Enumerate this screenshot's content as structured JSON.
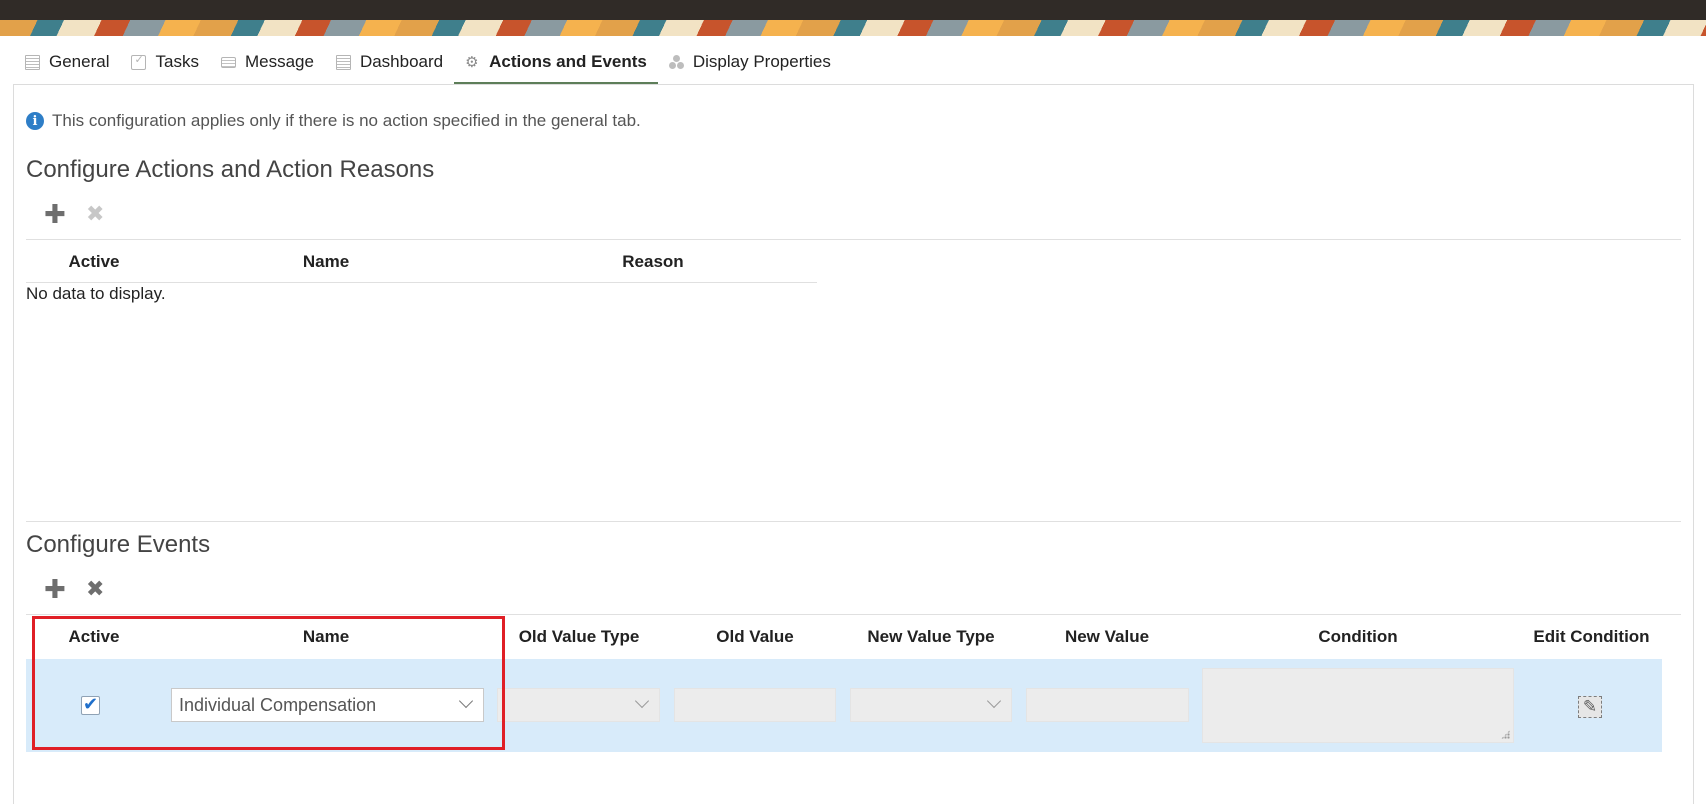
{
  "tabs": [
    {
      "label": "General",
      "icon": "document-icon"
    },
    {
      "label": "Tasks",
      "icon": "clipboard-check-icon"
    },
    {
      "label": "Message",
      "icon": "message-icon"
    },
    {
      "label": "Dashboard",
      "icon": "dashboard-icon"
    },
    {
      "label": "Actions and Events",
      "icon": "gears-icon",
      "active": true
    },
    {
      "label": "Display Properties",
      "icon": "circles-icon"
    }
  ],
  "info": {
    "text": "This configuration applies only if there is no action specified in the general tab.",
    "icon_glyph": "i"
  },
  "actions_section": {
    "title": "Configure Actions and Action Reasons",
    "add_glyph": "✚",
    "delete_glyph": "✖",
    "columns": [
      "Active",
      "Name",
      "Reason"
    ],
    "empty_text": "No data to display."
  },
  "events_section": {
    "title": "Configure Events",
    "add_glyph": "✚",
    "delete_glyph": "✖",
    "columns": [
      "Active",
      "Name",
      "Old Value Type",
      "Old Value",
      "New Value Type",
      "New Value",
      "Condition",
      "Edit Condition"
    ],
    "rows": [
      {
        "active": true,
        "name": "Individual Compensation",
        "old_value_type": "",
        "old_value": "",
        "new_value_type": "",
        "new_value": "",
        "condition": ""
      }
    ],
    "edit_glyph": "✎"
  },
  "colors": {
    "active_tab_underline": "#5d7e59",
    "info_icon": "#2e7ec7",
    "row_highlight": "#d8ebfa",
    "callout_border": "#e01f26"
  }
}
